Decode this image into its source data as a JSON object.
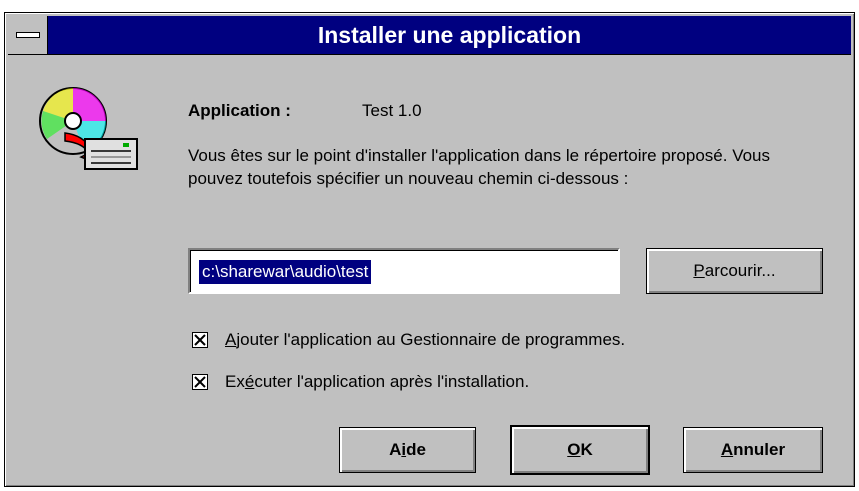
{
  "window": {
    "title": "Installer une application",
    "title_bar_color": "#000080",
    "face_color": "#c0c0c0"
  },
  "icon": {
    "name": "cd-install-icon"
  },
  "application": {
    "label": "Application :",
    "value": "Test 1.0"
  },
  "description": "Vous êtes sur le point d'installer l'application dans le répertoire proposé. Vous pouvez toutefois spécifier un nouveau chemin ci-dessous :",
  "path_field": {
    "value": "c:\\sharewar\\audio\\test",
    "selected": true
  },
  "buttons": {
    "browse": {
      "pre": "",
      "mnemonic": "P",
      "post": "arcourir..."
    },
    "help": {
      "pre": "A",
      "mnemonic": "i",
      "post": "de"
    },
    "ok": {
      "pre": "",
      "mnemonic": "O",
      "post": "K"
    },
    "cancel": {
      "pre": "",
      "mnemonic": "A",
      "post": "nnuler"
    }
  },
  "options": [
    {
      "checked": true,
      "pre": "",
      "mnemonic": "A",
      "post": "jouter l'application au Gestionnaire de programmes."
    },
    {
      "checked": true,
      "pre": "Ex",
      "mnemonic": "é",
      "post": "cuter l'application après l'installation."
    }
  ]
}
